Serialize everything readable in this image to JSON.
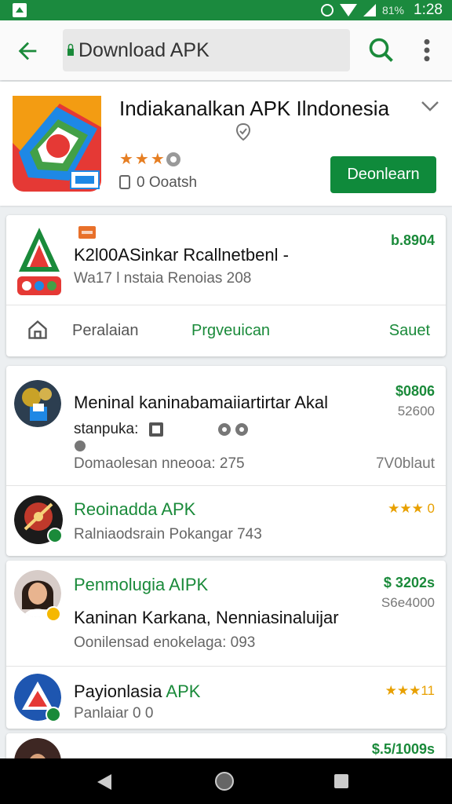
{
  "status_bar": {
    "battery": "81%",
    "time": "1:28"
  },
  "toolbar": {
    "search_text": "Download APK"
  },
  "app": {
    "title": "Indiakanalkan APK Ilndonesia",
    "stars": "★★★",
    "meta": "0 Ooatsh",
    "install_label": "Deonlearn",
    "accent": "#0f8a3b"
  },
  "featured": {
    "tag": "",
    "title": "K2l00ASinkar Rcallnetbenl -",
    "subtitle": "Wa17 l nstaia Renoias 208",
    "price": "b.8904",
    "tabs": [
      "Peralaian",
      "Prgveuican",
      "Sauet"
    ]
  },
  "list": [
    {
      "title": "Meninal kaninabamaiiartirtar Akal",
      "tagline": "stanpuka:",
      "subtitle": "Domaolesan nneooa: 275",
      "price": "$0806",
      "count": "52600",
      "right_note": "7V0blaut",
      "green": false
    },
    {
      "title": "Reoinadda APK",
      "subtitle": "Ralniaodsrain Pokangar 743",
      "rating": "★★★ 0",
      "green": true
    },
    {
      "title": "Penmolugia AIPK",
      "tagline": "Kaninan Karkana, Nenniasinaluijar",
      "subtitle": "Oonilensad enokelaga: 093",
      "price": "$ 3202s",
      "count": "S6e4000",
      "green": true
    },
    {
      "title_main": "Payionlasia",
      "title_accent": "APK",
      "subtitle": "Panlaiar 0 0",
      "rating": "★★★11",
      "green": false
    },
    {
      "price": "$.5/1009s"
    }
  ],
  "colors": {
    "status_green": "#1b8a3e",
    "star": "#e8a000",
    "price_green": "#1a8a3a"
  }
}
